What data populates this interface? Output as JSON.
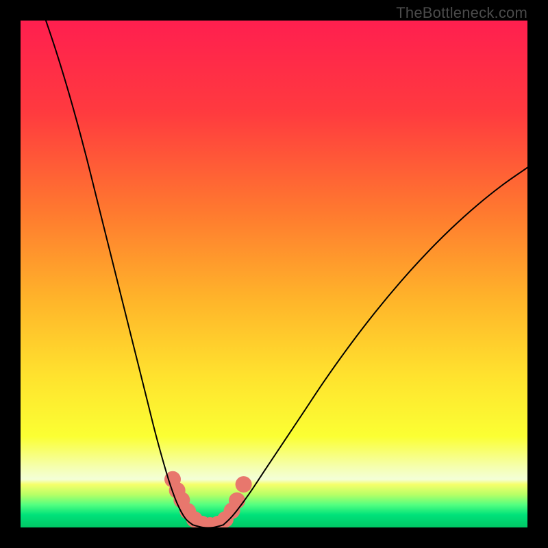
{
  "watermark": "TheBottleneck.com",
  "chart_data": {
    "type": "line",
    "title": "",
    "xlabel": "",
    "ylabel": "",
    "xlim": [
      0,
      100
    ],
    "ylim": [
      0,
      100
    ],
    "grid": false,
    "legend": false,
    "background_gradient": {
      "direction": "top-to-bottom",
      "stops": [
        {
          "pos": 0.0,
          "color": "#ff1f4f"
        },
        {
          "pos": 0.18,
          "color": "#ff3a3f"
        },
        {
          "pos": 0.38,
          "color": "#ff7a2f"
        },
        {
          "pos": 0.55,
          "color": "#ffb42a"
        },
        {
          "pos": 0.7,
          "color": "#ffe22e"
        },
        {
          "pos": 0.82,
          "color": "#fbff33"
        },
        {
          "pos": 0.88,
          "color": "#f5ffae"
        },
        {
          "pos": 0.905,
          "color": "#f3ffd8"
        },
        {
          "pos": 0.915,
          "color": "#f6ff6b"
        },
        {
          "pos": 0.935,
          "color": "#b8ff66"
        },
        {
          "pos": 0.955,
          "color": "#55ff80"
        },
        {
          "pos": 0.975,
          "color": "#00e27a"
        },
        {
          "pos": 1.0,
          "color": "#00c765"
        }
      ]
    },
    "series": [
      {
        "name": "left-branch",
        "color": "#000000",
        "width": 2,
        "x": [
          5,
          7,
          9,
          11,
          13,
          15,
          17,
          19,
          21,
          23,
          25,
          26.5,
          28,
          29.5,
          31,
          32.5,
          34
        ],
        "y": [
          100,
          94,
          87.5,
          80.5,
          73,
          65,
          57,
          49,
          41,
          33,
          25,
          19,
          13.5,
          8.5,
          4.5,
          1.8,
          0.5
        ]
      },
      {
        "name": "valley-floor",
        "color": "#000000",
        "width": 2,
        "x": [
          34,
          36,
          38,
          40
        ],
        "y": [
          0.5,
          0,
          0,
          0.5
        ]
      },
      {
        "name": "right-branch",
        "color": "#000000",
        "width": 2,
        "x": [
          40,
          42,
          45,
          48,
          52,
          56,
          60,
          65,
          70,
          75,
          80,
          85,
          90,
          95,
          100
        ],
        "y": [
          0.5,
          2.5,
          6.5,
          11,
          17,
          23,
          29,
          36,
          42.5,
          48.5,
          54,
          59,
          63.5,
          67.5,
          71
        ]
      }
    ],
    "markers": [
      {
        "name": "valley-dots",
        "color": "#e8776d",
        "radius": 12,
        "points": [
          {
            "x": 30.0,
            "y": 9.5
          },
          {
            "x": 30.9,
            "y": 7.3
          },
          {
            "x": 31.8,
            "y": 5.4
          },
          {
            "x": 33.0,
            "y": 3.2
          },
          {
            "x": 34.3,
            "y": 1.6
          },
          {
            "x": 35.8,
            "y": 0.7
          },
          {
            "x": 37.4,
            "y": 0.4
          },
          {
            "x": 39.0,
            "y": 0.7
          },
          {
            "x": 40.4,
            "y": 1.6
          },
          {
            "x": 41.7,
            "y": 3.3
          },
          {
            "x": 42.7,
            "y": 5.3
          },
          {
            "x": 44.0,
            "y": 8.5
          }
        ]
      }
    ]
  }
}
